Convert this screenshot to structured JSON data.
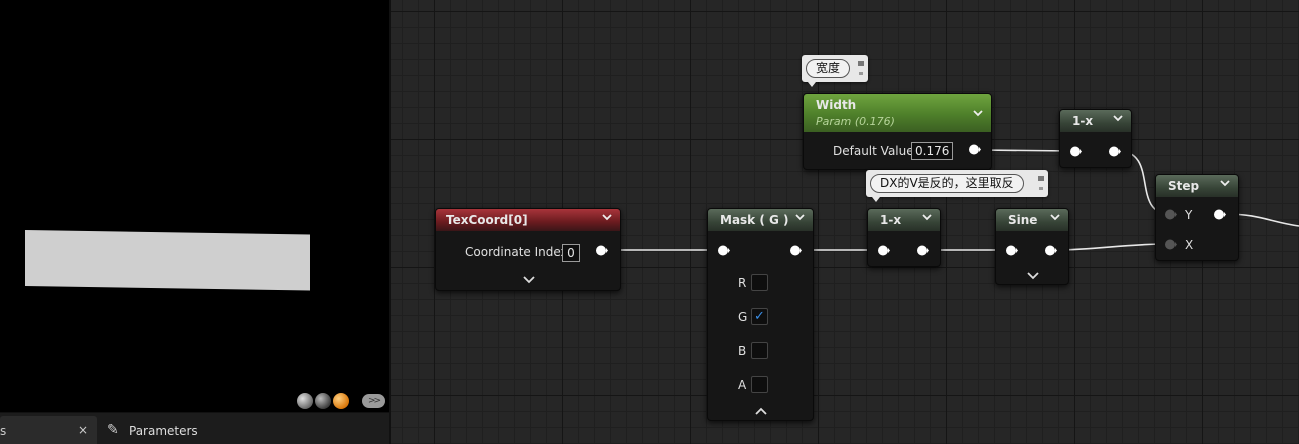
{
  "viewport": {
    "preview_buttons": [
      {
        "icon": "sphere-preview-icon"
      },
      {
        "icon": "shaded-sphere-icon"
      },
      {
        "icon": "material-ball-icon"
      }
    ],
    "options_icon": "double-chevron-icon"
  },
  "tabs": {
    "left_label": "s",
    "close_glyph": "×",
    "parameters_label": "Parameters",
    "parameters_icon": "pencil-icon"
  },
  "nodes": {
    "texcoord": {
      "title": "TexCoord[0]",
      "input_label": "Coordinate Index",
      "input_value": "0"
    },
    "mask": {
      "title": "Mask ( G )",
      "channels": [
        {
          "label": "R",
          "checked": false
        },
        {
          "label": "G",
          "checked": true
        },
        {
          "label": "B",
          "checked": false
        },
        {
          "label": "A",
          "checked": false
        }
      ]
    },
    "one_minus_a": {
      "title": "1-x"
    },
    "sine": {
      "title": "Sine"
    },
    "width": {
      "title": "Width",
      "subtitle": "Param (0.176)",
      "input_label": "Default Value",
      "input_value": "0.176"
    },
    "one_minus_b": {
      "title": "1-x"
    },
    "step": {
      "title": "Step",
      "inputs": [
        "Y",
        "X"
      ]
    }
  },
  "comments": {
    "width_comment": "宽度",
    "dx_comment": "DX的V是反的，这里取反"
  },
  "colors": {
    "graph_bg": "#262626",
    "texcoord_header": "#a8343a",
    "param_header": "#6fa43f",
    "math_header": "#4a5a4a",
    "checkbox_accent": "#3a8ee6"
  }
}
